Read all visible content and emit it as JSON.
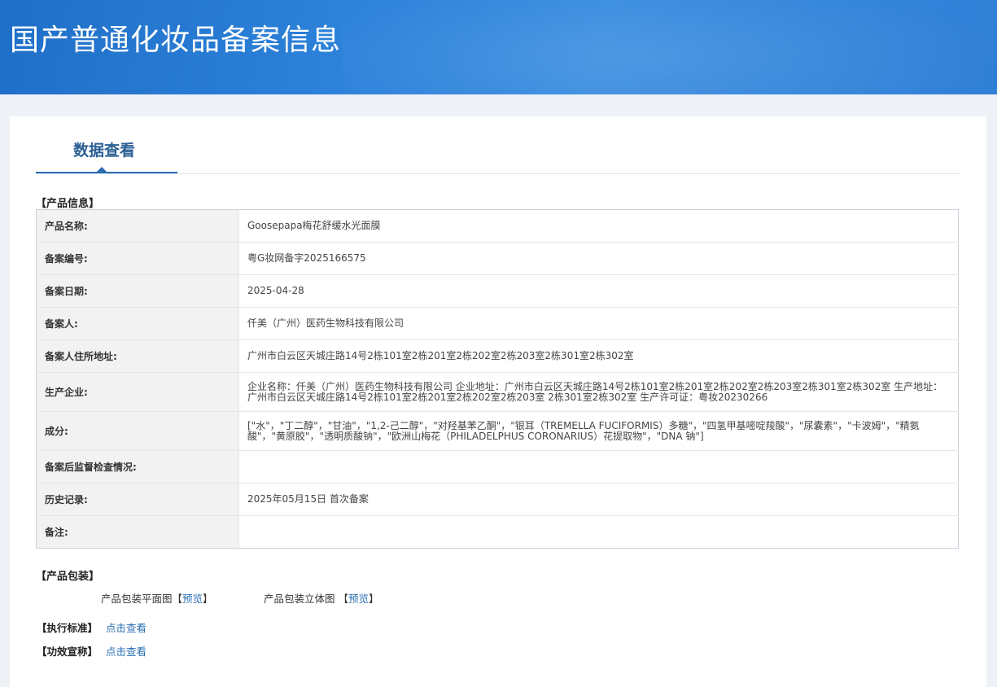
{
  "header": {
    "title": "国产普通化妆品备案信息"
  },
  "tab": {
    "label": "数据查看"
  },
  "product_section_title": "【产品信息】",
  "rows": [
    {
      "label": "产品名称:",
      "value": "Goosepapa梅花舒缓水光面膜"
    },
    {
      "label": "备案编号:",
      "value": "粤G妆网备字2025166575"
    },
    {
      "label": "备案日期:",
      "value": "2025-04-28"
    },
    {
      "label": "备案人:",
      "value": "仟美（广州）医药生物科技有限公司"
    },
    {
      "label": "备案人住所地址:",
      "value": "广州市白云区天城庄路14号2栋101室2栋201室2栋202室2栋203室2栋301室2栋302室"
    },
    {
      "label": "生产企业:",
      "value": "企业名称：仟美（广州）医药生物科技有限公司 企业地址：广州市白云区天城庄路14号2栋101室2栋201室2栋202室2栋203室2栋301室2栋302室 生产地址：广州市白云区天城庄路14号2栋101室2栋201室2栋202室2栋203室 2栋301室2栋302室 生产许可证：粤妆20230266"
    },
    {
      "label": "成分:",
      "value": "[\"水\"，\"丁二醇\"，\"甘油\"，\"1,2-己二醇\"，\"对羟基苯乙酮\"，\"银耳（TREMELLA FUCIFORMIS）多糖\"，\"四氢甲基嘧啶羧酸\"，\"尿囊素\"，\"卡波姆\"，\"精氨酸\"，\"黄原胶\"，\"透明质酸钠\"，\"欧洲山梅花（PHILADELPHUS CORONARIUS）花提取物\"，\"DNA 钠\"]"
    },
    {
      "label": "备案后监督检查情况:",
      "value": ""
    },
    {
      "label": "历史记录:",
      "value": "2025年05月15日 首次备案"
    },
    {
      "label": "备注:",
      "value": ""
    }
  ],
  "packaging": {
    "section_title": "【产品包装】",
    "flat_label": "产品包装平面图",
    "solid_label": "产品包装立体图",
    "preview_link": "预览"
  },
  "standard": {
    "label": "【执行标准】",
    "link": "点击查看"
  },
  "efficacy": {
    "label": "【功效宣称】",
    "link": "点击查看"
  }
}
